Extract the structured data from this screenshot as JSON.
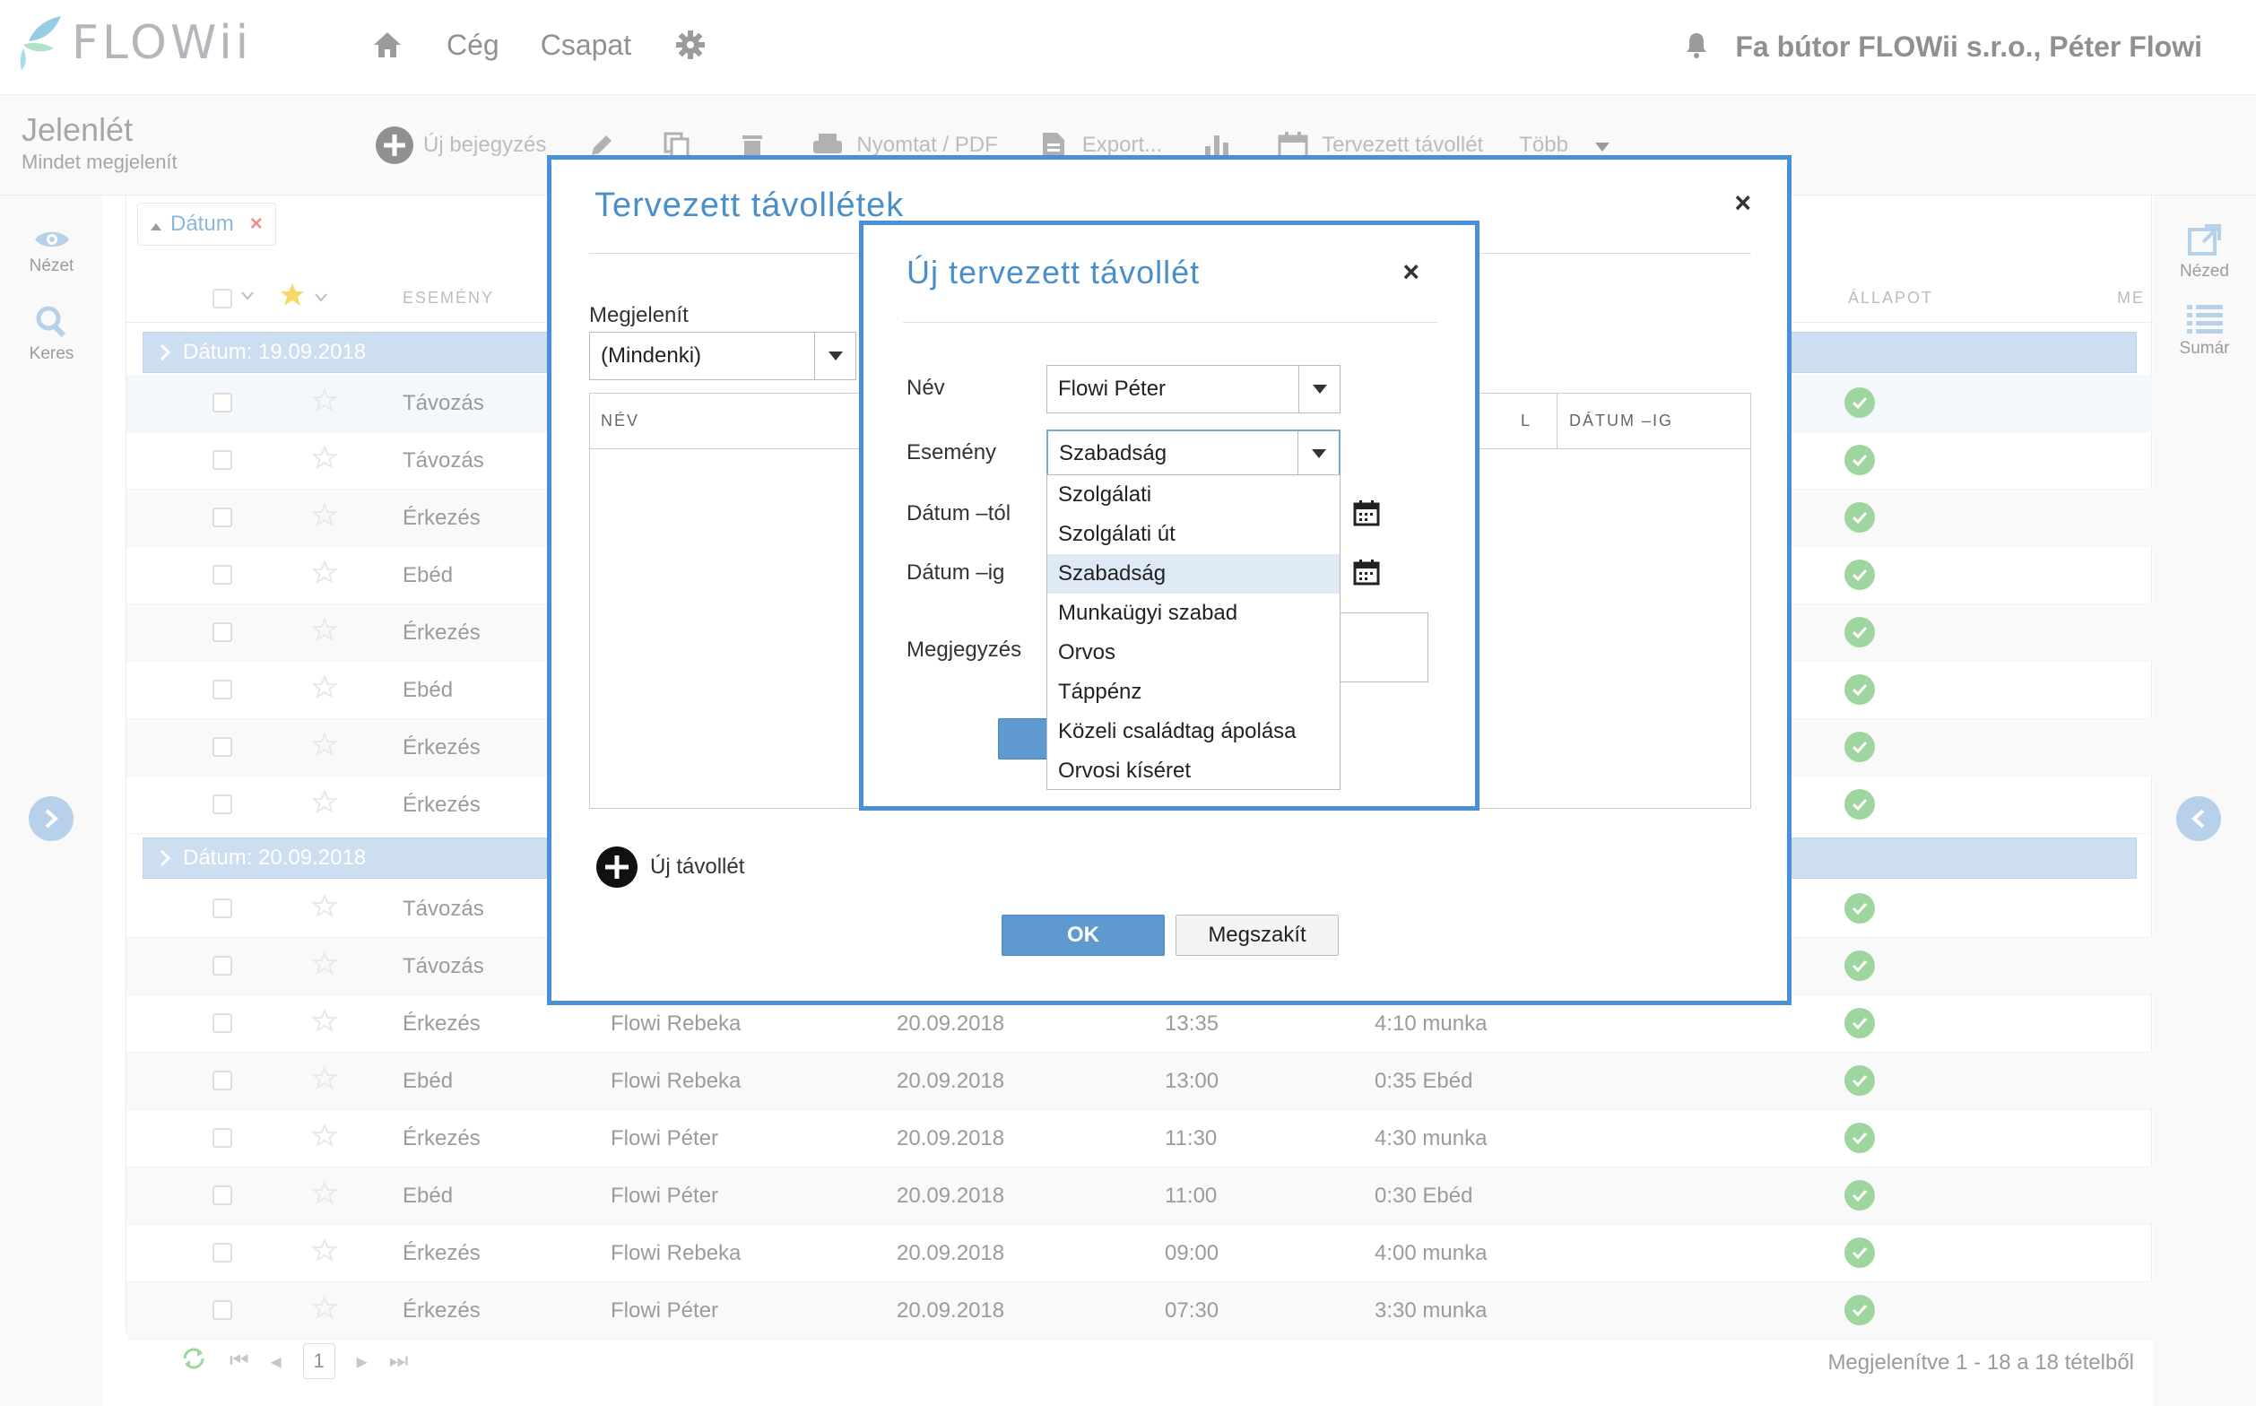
{
  "app": {
    "logo_text": "FLOWii",
    "nav": {
      "company": "Cég",
      "team": "Csapat"
    },
    "account_name": "Fa bútor FLOWii s.r.o., Péter Flowi"
  },
  "page": {
    "title": "Jelenlét",
    "subtitle": "Mindet megjelenít"
  },
  "toolbar": {
    "new_entry": "Új bejegyzés",
    "print": "Nyomtat / PDF",
    "export": "Export...",
    "planned_absence": "Tervezett távollét",
    "more": "Több"
  },
  "left_sidebar": {
    "view": "Nézet",
    "search": "Keres"
  },
  "right_sidebar": {
    "views": "Nézed",
    "summary": "Sumár"
  },
  "grid": {
    "filter_chip": "Dátum",
    "headers": {
      "event": "ESEMÉNY",
      "status": "ÁLLAPOT",
      "more": "MEG"
    },
    "groups": [
      {
        "label": "Dátum: 19.09.2018",
        "rows": [
          {
            "event": "Távozás",
            "name": "",
            "date": "",
            "time": "",
            "detail": ""
          },
          {
            "event": "Távozás",
            "name": "",
            "date": "",
            "time": "",
            "detail": ""
          },
          {
            "event": "Érkezés",
            "name": "",
            "date": "",
            "time": "",
            "detail": ""
          },
          {
            "event": "Ebéd",
            "name": "",
            "date": "",
            "time": "",
            "detail": ""
          },
          {
            "event": "Érkezés",
            "name": "",
            "date": "",
            "time": "",
            "detail": ""
          },
          {
            "event": "Ebéd",
            "name": "",
            "date": "",
            "time": "",
            "detail": ""
          },
          {
            "event": "Érkezés",
            "name": "",
            "date": "",
            "time": "",
            "detail": ""
          },
          {
            "event": "Érkezés",
            "name": "",
            "date": "",
            "time": "",
            "detail": ""
          }
        ]
      },
      {
        "label": "Dátum: 20.09.2018",
        "rows": [
          {
            "event": "Távozás",
            "name": "",
            "date": "",
            "time": "",
            "detail": ""
          },
          {
            "event": "Távozás",
            "name": "",
            "date": "",
            "time": "",
            "detail": ""
          },
          {
            "event": "Érkezés",
            "name": "Flowi Rebeka",
            "date": "20.09.2018",
            "time": "13:35",
            "detail": "4:10 munka"
          },
          {
            "event": "Ebéd",
            "name": "Flowi Rebeka",
            "date": "20.09.2018",
            "time": "13:00",
            "detail": "0:35 Ebéd"
          },
          {
            "event": "Érkezés",
            "name": "Flowi Péter",
            "date": "20.09.2018",
            "time": "11:30",
            "detail": "4:30 munka"
          },
          {
            "event": "Ebéd",
            "name": "Flowi Péter",
            "date": "20.09.2018",
            "time": "11:00",
            "detail": "0:30 Ebéd"
          },
          {
            "event": "Érkezés",
            "name": "Flowi Rebeka",
            "date": "20.09.2018",
            "time": "09:00",
            "detail": "4:00 munka"
          },
          {
            "event": "Érkezés",
            "name": "Flowi Péter",
            "date": "20.09.2018",
            "time": "07:30",
            "detail": "3:30 munka"
          }
        ]
      }
    ],
    "footer": {
      "page": "1",
      "summary": "Megjelenítve 1 - 18 a 18 tételből"
    }
  },
  "dialog_planned": {
    "title": "Tervezett távollétek",
    "close": "×",
    "show_label": "Megjelenít",
    "show_value": "(Mindenki)",
    "table_headers": {
      "name": "NÉV",
      "to_partial": "L",
      "date_to": "DÁTUM –IG"
    },
    "add_absence": "Új távollét",
    "ok": "OK",
    "cancel": "Megszakít"
  },
  "dialog_new": {
    "title": "Új tervezett távollét",
    "close": "×",
    "name_label": "Név",
    "name_value": "Flowi Péter",
    "event_label": "Esemény",
    "event_value": "Szabadság",
    "date_from_label": "Dátum –tól",
    "date_to_label": "Dátum –ig",
    "note_label": "Megjegyzés",
    "event_options": [
      "Szolgálati",
      "Szolgálati út",
      "Szabadság",
      "Munkaügyi szabad",
      "Orvos",
      "Táppénz",
      "Közeli családtag ápolása",
      "Orvosi kíséret"
    ],
    "selected_option": "Szabadság"
  },
  "colors": {
    "accent": "#4a90d9",
    "group_row": "#b2cce8",
    "status_ok": "#6cc06d",
    "button_primary": "#5e99d0"
  }
}
